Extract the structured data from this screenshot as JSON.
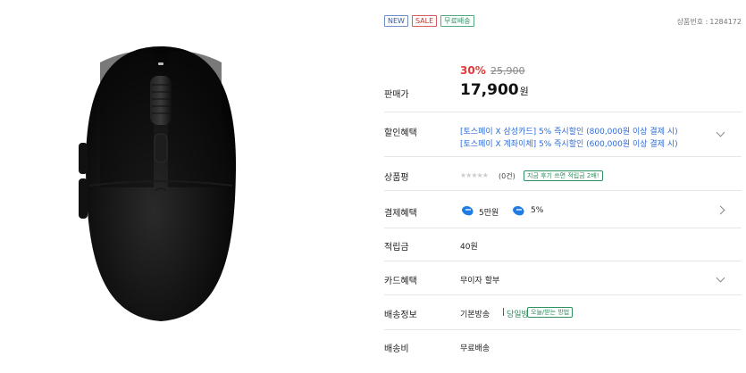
{
  "badges": [
    "NEW",
    "SALE",
    "무료배송"
  ],
  "product_id": {
    "label": "상품번호 :",
    "value": "1284172"
  },
  "price": {
    "discount_rate": "30%",
    "original": "25,900",
    "label": "판매가",
    "amount": "17,900",
    "unit": "원"
  },
  "discount": {
    "label": "할인혜택",
    "line1": "[토스페이 X 삼성카드] 5% 즉시할인 (800,000원 이상 결제 시)",
    "line2": "[토스페이 X 계좌이체] 5% 즉시할인 (600,000원 이상 결제 시)"
  },
  "review": {
    "label": "상품평",
    "stars": "★★★★★",
    "count": "(0건)",
    "tip": "지금 후기 쓰면 적립금 2배!"
  },
  "payment": {
    "label": "결제혜택",
    "benefit1": "5만원",
    "benefit2": "5%"
  },
  "points": {
    "label": "적립금",
    "value": "40원"
  },
  "card": {
    "label": "카드혜택",
    "value": "무이자 할부"
  },
  "shipping": {
    "label": "배송정보",
    "type": "기본방송",
    "divider": "|",
    "option": "당일방송",
    "tip": "오늘/받는 방법"
  },
  "shipping_fee": {
    "label": "배송비",
    "value": "무료배송"
  },
  "colors": {
    "accent_red": "#e03b3b",
    "link_blue": "#2f6cd8",
    "green": "#2f8f5f"
  },
  "icons": {
    "payment_icon": "toss-pay-icon",
    "chevron": "chevron-icon"
  }
}
